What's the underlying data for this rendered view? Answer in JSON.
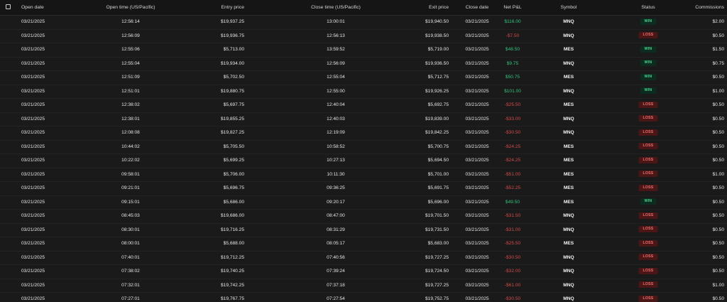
{
  "headers": {
    "open_date": "Open date",
    "open_time": "Open time (US/Pacific)",
    "entry_price": "Entry price",
    "close_time": "Close time (US/Pacific)",
    "exit_price": "Exit price",
    "close_date": "Close date",
    "net_pnl": "Net P&L",
    "symbol": "Symbol",
    "status": "Status",
    "commissions": "Commissions"
  },
  "rows": [
    {
      "open_date": "03/21/2025",
      "open_time": "12:56:14",
      "entry_price": "$19,937.25",
      "close_time": "13:00:01",
      "exit_price": "$19,940.50",
      "close_date": "03/21/2025",
      "net_pnl": "$116.00",
      "pnl_positive": true,
      "symbol": "MNQ",
      "status": "WIN",
      "commissions": "$2.00"
    },
    {
      "open_date": "03/21/2025",
      "open_time": "12:56:09",
      "entry_price": "$19,936.75",
      "close_time": "12:56:13",
      "exit_price": "$19,938.50",
      "close_date": "03/21/2025",
      "net_pnl": "-$7.50",
      "pnl_positive": false,
      "symbol": "MNQ",
      "status": "LOSS",
      "commissions": "$0.50"
    },
    {
      "open_date": "03/21/2025",
      "open_time": "12:55:06",
      "entry_price": "$5,713.00",
      "close_time": "13:59:52",
      "exit_price": "$5,719.00",
      "close_date": "03/21/2025",
      "net_pnl": "$48.50",
      "pnl_positive": true,
      "symbol": "MES",
      "status": "WIN",
      "commissions": "$1.50"
    },
    {
      "open_date": "03/21/2025",
      "open_time": "12:55:04",
      "entry_price": "$19,934.00",
      "close_time": "12:56:09",
      "exit_price": "$19,936.50",
      "close_date": "03/21/2025",
      "net_pnl": "$9.75",
      "pnl_positive": true,
      "symbol": "MNQ",
      "status": "WIN",
      "commissions": "$0.75"
    },
    {
      "open_date": "03/21/2025",
      "open_time": "12:51:09",
      "entry_price": "$5,702.50",
      "close_time": "12:55:04",
      "exit_price": "$5,712.75",
      "close_date": "03/21/2025",
      "net_pnl": "$50.75",
      "pnl_positive": true,
      "symbol": "MES",
      "status": "WIN",
      "commissions": "$0.50"
    },
    {
      "open_date": "03/21/2025",
      "open_time": "12:51:01",
      "entry_price": "$19,880.75",
      "close_time": "12:55:00",
      "exit_price": "$19,926.25",
      "close_date": "03/21/2025",
      "net_pnl": "$101.00",
      "pnl_positive": true,
      "symbol": "MNQ",
      "status": "WIN",
      "commissions": "$1.00"
    },
    {
      "open_date": "03/21/2025",
      "open_time": "12:38:02",
      "entry_price": "$5,697.75",
      "close_time": "12:40:04",
      "exit_price": "$5,692.75",
      "close_date": "03/21/2025",
      "net_pnl": "-$25.50",
      "pnl_positive": false,
      "symbol": "MES",
      "status": "LOSS",
      "commissions": "$0.50"
    },
    {
      "open_date": "03/21/2025",
      "open_time": "12:38:01",
      "entry_price": "$19,855.25",
      "close_time": "12:40:03",
      "exit_price": "$19,839.00",
      "close_date": "03/21/2025",
      "net_pnl": "-$33.00",
      "pnl_positive": false,
      "symbol": "MNQ",
      "status": "LOSS",
      "commissions": "$0.50"
    },
    {
      "open_date": "03/21/2025",
      "open_time": "12:08:08",
      "entry_price": "$19,827.25",
      "close_time": "12:19:09",
      "exit_price": "$19,842.25",
      "close_date": "03/21/2025",
      "net_pnl": "-$30.50",
      "pnl_positive": false,
      "symbol": "MNQ",
      "status": "LOSS",
      "commissions": "$0.50"
    },
    {
      "open_date": "03/21/2025",
      "open_time": "10:44:02",
      "entry_price": "$5,705.50",
      "close_time": "10:58:52",
      "exit_price": "$5,700.75",
      "close_date": "03/21/2025",
      "net_pnl": "-$24.25",
      "pnl_positive": false,
      "symbol": "MES",
      "status": "LOSS",
      "commissions": "$0.50"
    },
    {
      "open_date": "03/21/2025",
      "open_time": "10:22:02",
      "entry_price": "$5,699.25",
      "close_time": "10:27:13",
      "exit_price": "$5,694.50",
      "close_date": "03/21/2025",
      "net_pnl": "-$24.25",
      "pnl_positive": false,
      "symbol": "MES",
      "status": "LOSS",
      "commissions": "$0.50"
    },
    {
      "open_date": "03/21/2025",
      "open_time": "09:58:01",
      "entry_price": "$5,706.00",
      "close_time": "10:11:30",
      "exit_price": "$5,701.00",
      "close_date": "03/21/2025",
      "net_pnl": "-$51.00",
      "pnl_positive": false,
      "symbol": "MES",
      "status": "LOSS",
      "commissions": "$1.00"
    },
    {
      "open_date": "03/21/2025",
      "open_time": "09:21:01",
      "entry_price": "$5,696.75",
      "close_time": "09:36:25",
      "exit_price": "$5,691.75",
      "close_date": "03/21/2025",
      "net_pnl": "-$52.25",
      "pnl_positive": false,
      "symbol": "MES",
      "status": "LOSS",
      "commissions": "$0.50"
    },
    {
      "open_date": "03/21/2025",
      "open_time": "09:15:01",
      "entry_price": "$5,686.00",
      "close_time": "09:20:17",
      "exit_price": "$5,696.00",
      "close_date": "03/21/2025",
      "net_pnl": "$49.50",
      "pnl_positive": true,
      "symbol": "MES",
      "status": "WIN",
      "commissions": "$0.50"
    },
    {
      "open_date": "03/21/2025",
      "open_time": "08:45:03",
      "entry_price": "$19,686.00",
      "close_time": "08:47:00",
      "exit_price": "$19,701.50",
      "close_date": "03/21/2025",
      "net_pnl": "-$31.50",
      "pnl_positive": false,
      "symbol": "MNQ",
      "status": "LOSS",
      "commissions": "$0.50"
    },
    {
      "open_date": "03/21/2025",
      "open_time": "08:30:01",
      "entry_price": "$19,716.25",
      "close_time": "08:31:29",
      "exit_price": "$19,731.50",
      "close_date": "03/21/2025",
      "net_pnl": "-$31.00",
      "pnl_positive": false,
      "symbol": "MNQ",
      "status": "LOSS",
      "commissions": "$0.50"
    },
    {
      "open_date": "03/21/2025",
      "open_time": "08:00:01",
      "entry_price": "$5,688.00",
      "close_time": "08:05:17",
      "exit_price": "$5,683.00",
      "close_date": "03/21/2025",
      "net_pnl": "-$25.50",
      "pnl_positive": false,
      "symbol": "MES",
      "status": "LOSS",
      "commissions": "$0.50"
    },
    {
      "open_date": "03/21/2025",
      "open_time": "07:40:01",
      "entry_price": "$19,712.25",
      "close_time": "07:40:56",
      "exit_price": "$19,727.25",
      "close_date": "03/21/2025",
      "net_pnl": "-$30.50",
      "pnl_positive": false,
      "symbol": "MNQ",
      "status": "LOSS",
      "commissions": "$0.50"
    },
    {
      "open_date": "03/21/2025",
      "open_time": "07:38:02",
      "entry_price": "$19,740.25",
      "close_time": "07:39:24",
      "exit_price": "$19,724.50",
      "close_date": "03/21/2025",
      "net_pnl": "-$32.00",
      "pnl_positive": false,
      "symbol": "MNQ",
      "status": "LOSS",
      "commissions": "$0.50"
    },
    {
      "open_date": "03/21/2025",
      "open_time": "07:32:01",
      "entry_price": "$19,742.25",
      "close_time": "07:37:18",
      "exit_price": "$19,727.25",
      "close_date": "03/21/2025",
      "net_pnl": "-$61.00",
      "pnl_positive": false,
      "symbol": "MNQ",
      "status": "LOSS",
      "commissions": "$1.00"
    },
    {
      "open_date": "03/21/2025",
      "open_time": "07:27:01",
      "entry_price": "$19,767.75",
      "close_time": "07:27:54",
      "exit_price": "$19,752.75",
      "close_date": "03/21/2025",
      "net_pnl": "-$30.50",
      "pnl_positive": false,
      "symbol": "MNQ",
      "status": "LOSS",
      "commissions": "$0.50"
    }
  ]
}
